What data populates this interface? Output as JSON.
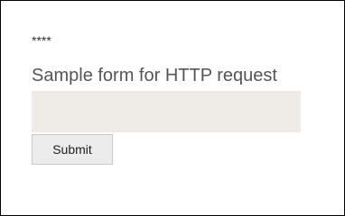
{
  "header": {
    "masked_text": "****"
  },
  "form": {
    "title": "Sample form for HTTP request",
    "input_value": "",
    "input_placeholder": "",
    "submit_label": "Submit"
  }
}
